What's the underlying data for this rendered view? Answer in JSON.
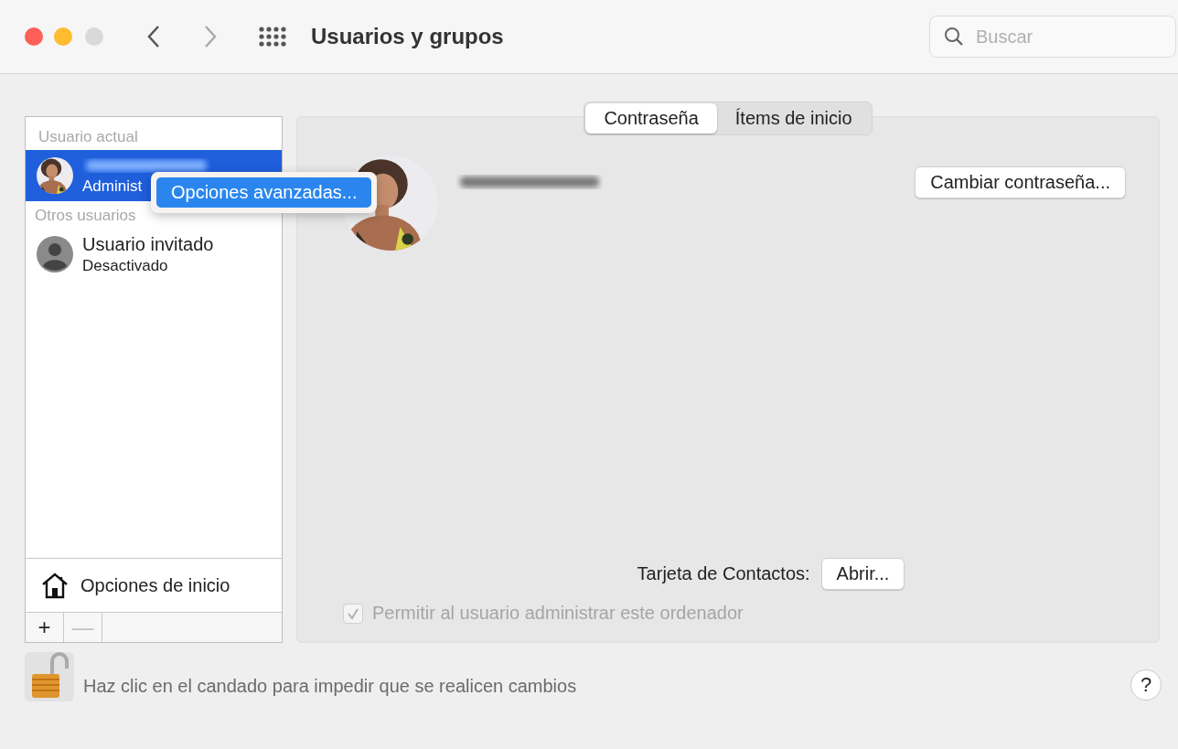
{
  "window": {
    "title": "Usuarios y grupos"
  },
  "search": {
    "placeholder": "Buscar"
  },
  "sidebar": {
    "sections": [
      {
        "header": "Usuario actual",
        "users": [
          {
            "subtitle": "Administ",
            "selected": true
          }
        ]
      },
      {
        "header": "Otros usuarios",
        "users": [
          {
            "kind": "guest",
            "name": "Usuario invitado",
            "subtitle": "Desactivado",
            "selected": false
          }
        ]
      }
    ],
    "login_options": "Opciones de inicio",
    "add_button": {
      "label": "+",
      "disabled": false
    },
    "remove_button": {
      "label": "—",
      "disabled": true
    }
  },
  "context_menu": {
    "items": [
      {
        "label": "Opciones avanzadas...",
        "selected": true
      }
    ]
  },
  "tabs": [
    {
      "label": "Contraseña",
      "selected": true
    },
    {
      "label": "Ítems de inicio",
      "selected": false
    }
  ],
  "account": {
    "change_password": "Cambiar contraseña...",
    "contacts_label": "Tarjeta de Contactos:",
    "open_button": "Abrir...",
    "allow_admin": {
      "label": "Permitir al usuario administrar este ordenador",
      "checked": true,
      "disabled": true
    }
  },
  "lock": {
    "text": "Haz clic en el candado para impedir que se realicen cambios",
    "locked": false
  },
  "help": "?"
}
